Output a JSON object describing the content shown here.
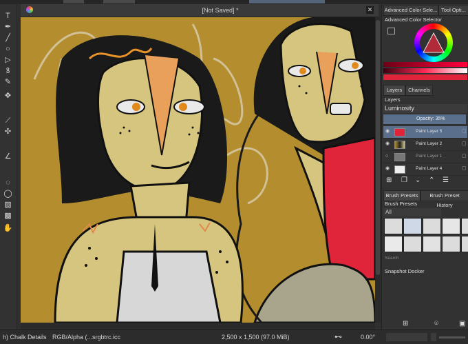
{
  "window": {
    "title": "[Not Saved]",
    "modified_marker": "*"
  },
  "toolbox": {
    "icons": [
      "text-tool-icon",
      "calligraphy-icon",
      "line-icon",
      "ellipse-icon",
      "polygon-icon",
      "bezier-icon",
      "multibrush-icon",
      "move-icon",
      "eyedropper-icon",
      "assistant-icon",
      "measure-icon",
      "ellipse-select-icon",
      "freehand-select-icon",
      "contiguous-select-icon",
      "similar-select-icon",
      "pan-icon"
    ]
  },
  "panel": {
    "tabs": [
      "Advanced Color Sele...",
      "Tool Opti..."
    ],
    "color_selector_title": "Advanced Color Selector",
    "layers_tabs": [
      "Layers",
      "Channels"
    ],
    "layers_title": "Layers",
    "blend_mode": "Luminosity",
    "opacity_label": "Opacity:  35%",
    "layers": [
      {
        "name": "Paint Layer 5",
        "visible": true,
        "selected": true
      },
      {
        "name": "Paint Layer 2",
        "visible": true,
        "selected": false
      },
      {
        "name": "Paint Layer 1",
        "visible": false,
        "selected": false
      },
      {
        "name": "Paint Layer 4",
        "visible": true,
        "selected": false
      }
    ],
    "brush_tabs": [
      "Brush Presets",
      "Brush Preset History"
    ],
    "brush_presets_title": "Brush Presets",
    "brush_filter": "All",
    "search_placeholder": "Search",
    "snapshot_title": "Snapshot Docker"
  },
  "status": {
    "brush": "h) Chalk Details",
    "colorspace": "RGB/Alpha (...srgbtrc.icc",
    "dimensions": "2,500 x 1,500 (97.0 MiB)",
    "rotation": "0.00°"
  },
  "colors": {
    "accent": "#5a6f8c",
    "red": "#e0243a",
    "canvas_bg": "#b38d2e"
  }
}
